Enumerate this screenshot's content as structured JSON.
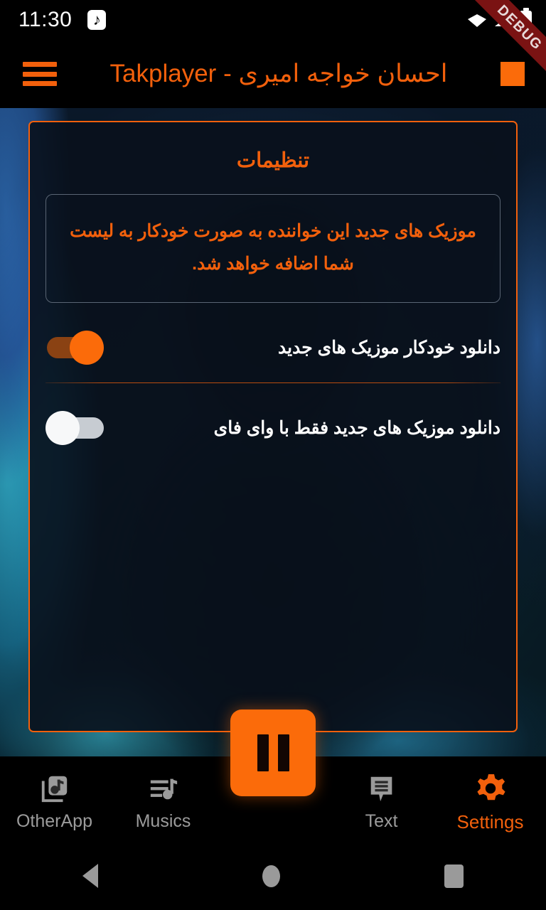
{
  "status_bar": {
    "time": "11:30",
    "notification_icon": "music-note-icon",
    "wifi_icon": "wifi-icon",
    "signal_icon": "cellular-signal-icon",
    "battery_icon": "battery-icon"
  },
  "debug_banner": {
    "label": "DEBUG",
    "color": "#7a1313"
  },
  "app_bar": {
    "menu_icon": "hamburger-menu-icon",
    "title": "احسان خواجه امیری - Takplayer",
    "stop_icon": "stop-square-icon",
    "accent": "#F2600C"
  },
  "settings_panel": {
    "title": "تنظیمات",
    "notice": "موزیک های جدید این خواننده به صورت خودکار به لیست شما اضافه خواهد شد.",
    "border_color": "#F2600C",
    "rows": [
      {
        "label": "دانلود خودکار موزیک های جدید",
        "state": "on",
        "toggle_name": "auto-download-new-music-toggle"
      },
      {
        "label": "دانلود موزیک های جدید فقط با وای فای",
        "state": "off",
        "toggle_name": "wifi-only-download-toggle"
      }
    ]
  },
  "player": {
    "fab_icon": "pause-icon",
    "fab_color": "#FB6B0A"
  },
  "bottom_nav": {
    "items": [
      {
        "label": "OtherApp",
        "icon": "library-music-icon",
        "active": false
      },
      {
        "label": "Musics",
        "icon": "queue-music-icon",
        "active": false
      },
      {
        "label": "Text",
        "icon": "comment-text-icon",
        "active": false
      },
      {
        "label": "Settings",
        "icon": "gear-icon",
        "active": true
      }
    ],
    "active_color": "#F2600C",
    "inactive_color": "#9b9b9b"
  },
  "system_nav": {
    "back_icon": "back-triangle-icon",
    "home_icon": "home-circle-icon",
    "recents_icon": "recents-square-icon"
  }
}
